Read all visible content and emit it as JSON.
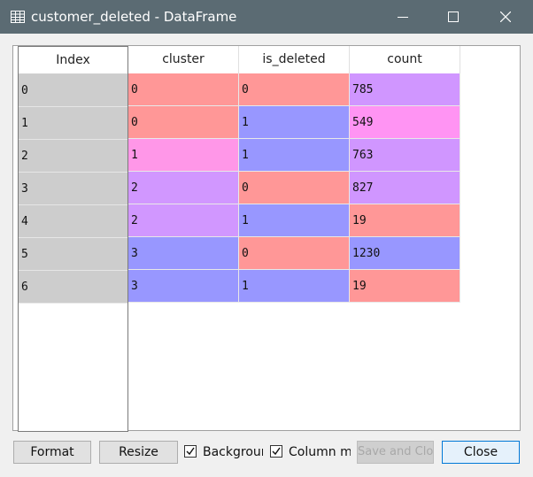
{
  "window": {
    "title": "customer_deleted - DataFrame"
  },
  "table": {
    "index_header": "Index",
    "columns": [
      "cluster",
      "is_deleted",
      "count"
    ],
    "rows": [
      {
        "index": "0",
        "cells": [
          "0",
          "0",
          "785"
        ],
        "colors": [
          "#ff9797",
          "#ff9797",
          "#d096ff"
        ]
      },
      {
        "index": "1",
        "cells": [
          "0",
          "1",
          "549"
        ],
        "colors": [
          "#ff9797",
          "#9897ff",
          "#ff94f3"
        ]
      },
      {
        "index": "2",
        "cells": [
          "1",
          "1",
          "763"
        ],
        "colors": [
          "#ff97e8",
          "#9897ff",
          "#d096ff"
        ]
      },
      {
        "index": "3",
        "cells": [
          "2",
          "0",
          "827"
        ],
        "colors": [
          "#d197ff",
          "#ff9797",
          "#d096ff"
        ]
      },
      {
        "index": "4",
        "cells": [
          "2",
          "1",
          "19"
        ],
        "colors": [
          "#d197ff",
          "#9897ff",
          "#ff9797"
        ]
      },
      {
        "index": "5",
        "cells": [
          "3",
          "0",
          "1230"
        ],
        "colors": [
          "#9897ff",
          "#ff9797",
          "#9897ff"
        ]
      },
      {
        "index": "6",
        "cells": [
          "3",
          "1",
          "19"
        ],
        "colors": [
          "#9897ff",
          "#9897ff",
          "#ff9797"
        ]
      }
    ]
  },
  "footer": {
    "format_label": "Format",
    "resize_label": "Resize",
    "background_label": "Background color",
    "background_checked": true,
    "column_min_label": "Column min/max",
    "column_min_checked": true,
    "save_label": "Save and Close",
    "close_label": "Close"
  }
}
